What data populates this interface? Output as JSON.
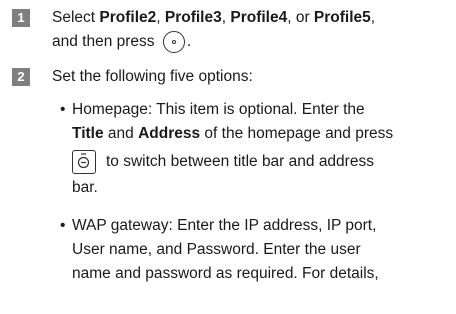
{
  "step1": {
    "number": "1",
    "prefix": "Select ",
    "p2": "Profile2",
    "sep1": ", ",
    "p3": "Profile3",
    "sep2": ", ",
    "p4": "Profile4",
    "sep3": ", or ",
    "p5": "Profile5",
    "sep4": ",",
    "line2": "and then press",
    "line2_end": ".",
    "key_icon": "ok-key-icon"
  },
  "step2": {
    "number": "2",
    "text": "Set the following five options:"
  },
  "bullet1": {
    "dot": "•",
    "line1": "Homepage: This item is optional. Enter the",
    "title_word": "Title",
    "and_word": " and ",
    "address_word": "Address",
    "line2_rest": " of the homepage and press",
    "line3": "to switch between title bar and address",
    "line4": "bar.",
    "key_icon": "navigation-key-icon"
  },
  "bullet2": {
    "dot": "•",
    "line1": "WAP gateway: Enter the IP address, IP port,",
    "line2": "User name, and Password. Enter the user",
    "line3": "name and password as required. For details,"
  }
}
